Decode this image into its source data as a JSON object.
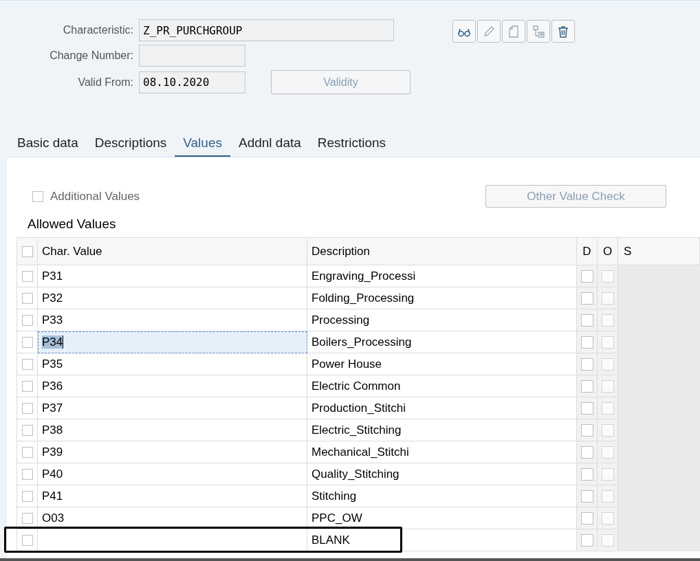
{
  "header": {
    "fields": [
      {
        "label": "Characteristic:",
        "value": "Z_PR_PURCHGROUP",
        "kind": "wide"
      },
      {
        "label": "Change Number:",
        "kind": "short"
      },
      {
        "label": "Valid From:",
        "value": "08.10.2020",
        "kind": "short"
      }
    ],
    "validity_button": {
      "label": "Validity",
      "disabled": true
    },
    "toolbar": [
      {
        "kind": "display",
        "disabled": false
      },
      {
        "kind": "edit",
        "disabled": true
      },
      {
        "kind": "copy",
        "disabled": true
      },
      {
        "kind": "where-used",
        "disabled": true
      },
      {
        "kind": "delete",
        "disabled": false
      }
    ]
  },
  "tabs": [
    {
      "label": "Basic data",
      "selected": false
    },
    {
      "label": "Descriptions",
      "selected": false
    },
    {
      "label": "Values",
      "selected": true
    },
    {
      "label": "Addnl data",
      "selected": false
    },
    {
      "label": "Restrictions",
      "selected": false
    }
  ],
  "additional_values": {
    "label": "Additional Values",
    "checked": false
  },
  "other_value_check": {
    "label": "Other Value Check",
    "disabled": true
  },
  "table": {
    "title": "Allowed Values",
    "select_all": {
      "checked": false
    },
    "columns": [
      "Char. Value",
      "Description",
      "D",
      "O",
      "S"
    ],
    "rows": [
      {
        "value": "P31",
        "description": "Engraving_Processi",
        "selected": false,
        "d": false,
        "o": false,
        "focused": false
      },
      {
        "value": "P32",
        "description": "Folding_Processing",
        "selected": false,
        "d": false,
        "o": false,
        "focused": false
      },
      {
        "value": "P33",
        "description": "Processing",
        "selected": false,
        "d": false,
        "o": false,
        "focused": false
      },
      {
        "value": "P34",
        "description": "Boilers_Processing",
        "selected": false,
        "d": false,
        "o": false,
        "focused": true
      },
      {
        "value": "P35",
        "description": "Power House",
        "selected": false,
        "d": false,
        "o": false,
        "focused": false
      },
      {
        "value": "P36",
        "description": "Electric Common",
        "selected": false,
        "d": false,
        "o": false,
        "focused": false
      },
      {
        "value": "P37",
        "description": "Production_Stitchi",
        "selected": false,
        "d": false,
        "o": false,
        "focused": false
      },
      {
        "value": "P38",
        "description": "Electric_Stitching",
        "selected": false,
        "d": false,
        "o": false,
        "focused": false
      },
      {
        "value": "P39",
        "description": "Mechanical_Stitchi",
        "selected": false,
        "d": false,
        "o": false,
        "focused": false
      },
      {
        "value": "P40",
        "description": "Quality_Stitching",
        "selected": false,
        "d": false,
        "o": false,
        "focused": false
      },
      {
        "value": "P41",
        "description": "Stitching",
        "selected": false,
        "d": false,
        "o": false,
        "focused": false
      },
      {
        "value": "O03",
        "description": "PPC_OW",
        "selected": false,
        "d": false,
        "o": false,
        "focused": false
      },
      {
        "description": "BLANK",
        "selected": false,
        "d": false,
        "o": false,
        "focused": false,
        "highlighted": true
      }
    ]
  }
}
